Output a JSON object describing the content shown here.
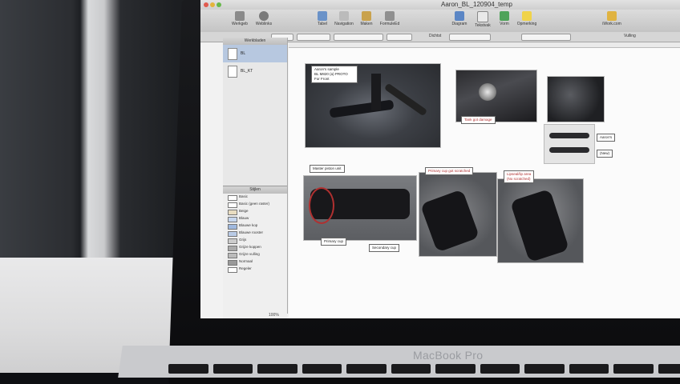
{
  "window": {
    "title": "Aaron_BL_120904_temp"
  },
  "toolbar": {
    "left_buttons": [
      {
        "label": "Werkgeb",
        "icon": "canvases-icon"
      },
      {
        "label": "Weblinks",
        "icon": "gear-icon"
      }
    ],
    "center_buttons": [
      {
        "label": "Tabel",
        "icon": "table-icon"
      },
      {
        "label": "Navigation",
        "icon": "navigation-icon"
      },
      {
        "label": "Maken",
        "icon": "make-icon"
      },
      {
        "label": "FormuleEd",
        "icon": "formula-icon"
      }
    ],
    "right_buttons": [
      {
        "label": "Diagram",
        "icon": "diagram-icon"
      },
      {
        "label": "Tekstvak",
        "icon": "textbox-icon"
      },
      {
        "label": "Vorm",
        "icon": "shape-icon"
      },
      {
        "label": "Opmerking",
        "icon": "comment-icon"
      }
    ],
    "far_right": {
      "label": "iWork.com",
      "icon": "iwork-icon"
    }
  },
  "format_bar": {
    "zoom_label": "Dichtst",
    "setting_label": "Vulling"
  },
  "sidebar": {
    "header": "Werkbladen",
    "sheets": [
      {
        "label": "BL",
        "selected": true
      },
      {
        "label": "BL_KT",
        "selected": false
      }
    ],
    "styles_header": "Stijlen",
    "styles": [
      "Basic",
      "Basic (geen raster)",
      "Beige",
      "Blauw",
      "Blauwe kop",
      "Blauwe rooster",
      "Grijs",
      "Grijze koppen",
      "Grijze vulling",
      "Normaal",
      "Regeler"
    ]
  },
  "canvas": {
    "notes": [
      {
        "id": "note-sample",
        "lines": [
          "Aaron's sample",
          "BL M820 (a) PROTO",
          "For Front"
        ]
      },
      {
        "id": "note-bolt",
        "lines": [
          "Tank got damage"
        ]
      },
      {
        "id": "note-aaron",
        "lines": [
          "Aaron's"
        ]
      },
      {
        "id": "note-new",
        "lines": [
          "(New)"
        ]
      },
      {
        "id": "note-master",
        "lines": [
          "Master piston unit"
        ]
      },
      {
        "id": "note-primary",
        "lines": [
          "Primary cup got scratched"
        ]
      },
      {
        "id": "note-lipseal",
        "lines": [
          "Lipseal/lip area",
          "(No scratched)"
        ]
      },
      {
        "id": "note-primarycup",
        "lines": [
          "Primary cup"
        ]
      },
      {
        "id": "note-secondary",
        "lines": [
          "Secondary cup"
        ]
      }
    ]
  },
  "status": {
    "zoom": "100%"
  },
  "device": {
    "brand": "MacBook Pro"
  },
  "colors": {
    "accent": "#3a6ea5",
    "red_note": "#b03030"
  }
}
